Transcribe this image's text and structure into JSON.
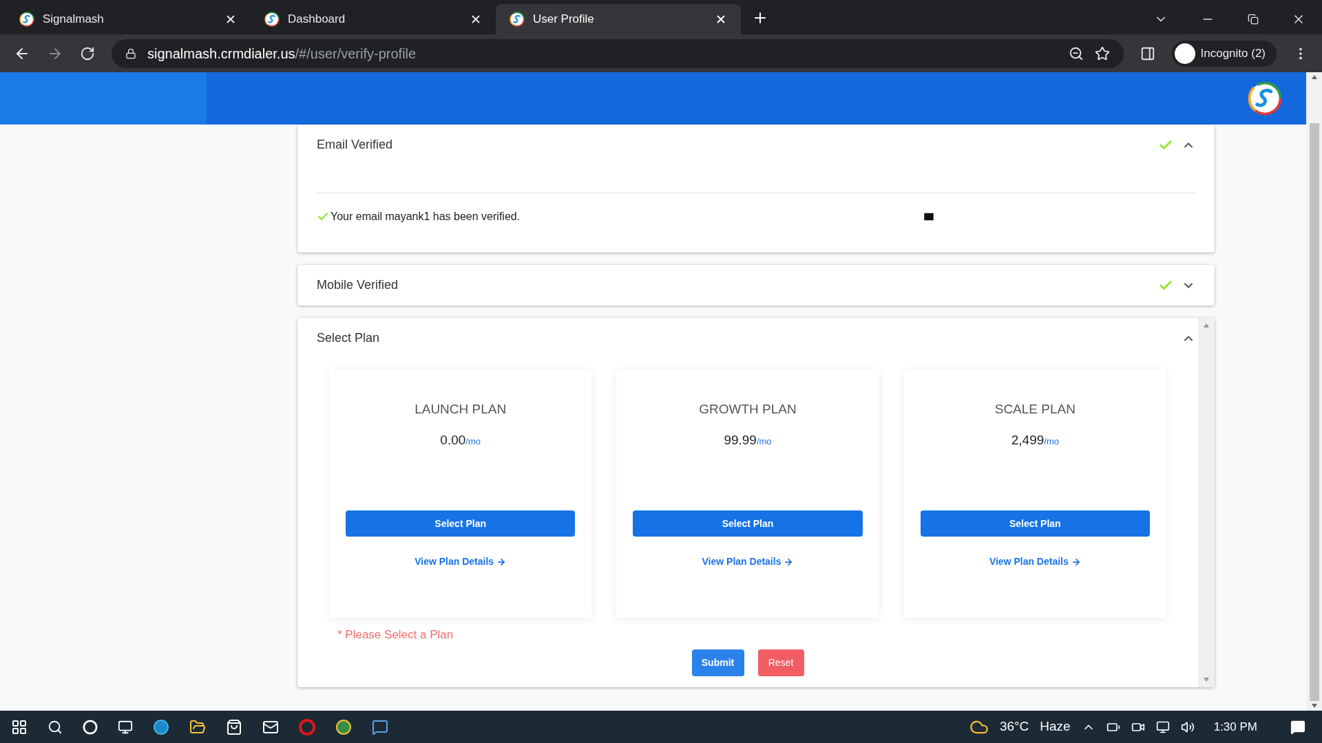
{
  "browser": {
    "tabs": [
      {
        "title": "Signalmash",
        "selected": false
      },
      {
        "title": "Dashboard",
        "selected": false
      },
      {
        "title": "User Profile",
        "selected": true
      }
    ],
    "url_host": "signalmash.crmdialer.us",
    "url_path": "/#/user/verify-profile",
    "profile": "Incognito (2)"
  },
  "sections": [
    {
      "kind": "email",
      "title": "Email Verified",
      "verified": true,
      "expanded": true,
      "message": "Your email mayank1 has been verified."
    },
    {
      "kind": "mobile",
      "title": "Mobile Verified",
      "verified": true,
      "expanded": false
    },
    {
      "kind": "plans",
      "title": "Select Plan",
      "verified": false,
      "expanded": true,
      "plans": [
        {
          "name": "LAUNCH PLAN",
          "price": "0.00",
          "period": "/mo",
          "button": "Select Plan",
          "link": "View Plan Details"
        },
        {
          "name": "GROWTH PLAN",
          "price": "99.99",
          "period": "/mo",
          "button": "Select Plan",
          "link": "View Plan Details"
        },
        {
          "name": "SCALE PLAN",
          "price": "2,499",
          "period": "/mo",
          "button": "Select Plan",
          "link": "View Plan Details"
        }
      ],
      "error": "* Please Select a Plan",
      "submit": "Submit",
      "reset": "Reset"
    }
  ],
  "taskbar": {
    "weather": "36°C",
    "condition": "Haze",
    "time": "1:30 PM"
  }
}
